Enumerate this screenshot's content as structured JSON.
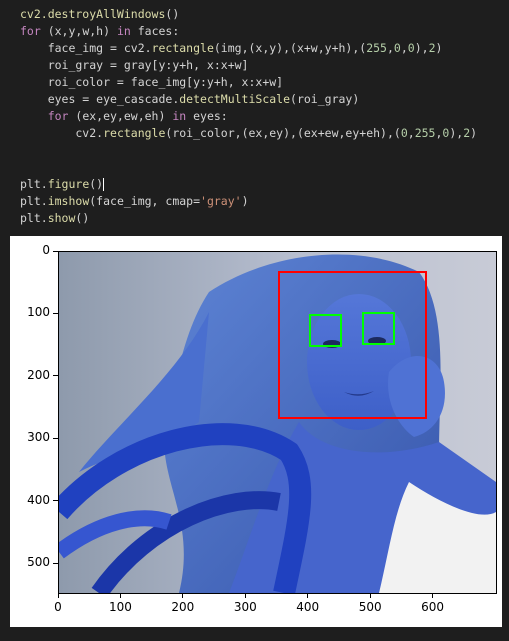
{
  "code": {
    "lines": [
      [
        {
          "t": "cv2.destroyAllWindows",
          "c": "fn"
        },
        {
          "t": "()",
          "c": "pl"
        }
      ],
      [
        {
          "t": "for",
          "c": "kw2"
        },
        {
          "t": " (x,y,w,h) ",
          "c": "pl"
        },
        {
          "t": "in",
          "c": "kw2"
        },
        {
          "t": " faces:",
          "c": "pl"
        }
      ],
      [
        {
          "t": "    face_img = cv2.",
          "c": "pl"
        },
        {
          "t": "rectangle",
          "c": "fn"
        },
        {
          "t": "(img,(x,y),(x+w,y+h),(",
          "c": "pl"
        },
        {
          "t": "255",
          "c": "num"
        },
        {
          "t": ",",
          "c": "pl"
        },
        {
          "t": "0",
          "c": "num"
        },
        {
          "t": ",",
          "c": "pl"
        },
        {
          "t": "0",
          "c": "num"
        },
        {
          "t": "),",
          "c": "pl"
        },
        {
          "t": "2",
          "c": "num"
        },
        {
          "t": ")",
          "c": "pl"
        }
      ],
      [
        {
          "t": "    roi_gray = gray[y:y+h, x:x+w]",
          "c": "pl"
        }
      ],
      [
        {
          "t": "    roi_color = face_img[y:y+h, x:x+w]",
          "c": "pl"
        }
      ],
      [
        {
          "t": "    eyes = eye_cascade.",
          "c": "pl"
        },
        {
          "t": "detectMultiScale",
          "c": "fn"
        },
        {
          "t": "(roi_gray)",
          "c": "pl"
        }
      ],
      [
        {
          "t": "    for",
          "c": "kw2"
        },
        {
          "t": " (ex,ey,ew,eh) ",
          "c": "pl"
        },
        {
          "t": "in",
          "c": "kw2"
        },
        {
          "t": " eyes:",
          "c": "pl"
        }
      ],
      [
        {
          "t": "        cv2.",
          "c": "pl"
        },
        {
          "t": "rectangle",
          "c": "fn"
        },
        {
          "t": "(roi_color,(ex,ey),(ex+ew,ey+eh),(",
          "c": "pl"
        },
        {
          "t": "0",
          "c": "num"
        },
        {
          "t": ",",
          "c": "pl"
        },
        {
          "t": "255",
          "c": "num"
        },
        {
          "t": ",",
          "c": "pl"
        },
        {
          "t": "0",
          "c": "num"
        },
        {
          "t": "),",
          "c": "pl"
        },
        {
          "t": "2",
          "c": "num"
        },
        {
          "t": ")",
          "c": "pl"
        }
      ],
      [],
      [],
      [
        {
          "t": "plt.",
          "c": "pl"
        },
        {
          "t": "figure",
          "c": "fn"
        },
        {
          "t": "()",
          "c": "pl"
        },
        {
          "t": "",
          "c": "cursor"
        }
      ],
      [
        {
          "t": "plt.",
          "c": "pl"
        },
        {
          "t": "imshow",
          "c": "fn"
        },
        {
          "t": "(face_img, cmap=",
          "c": "pl"
        },
        {
          "t": "'gray'",
          "c": "str"
        },
        {
          "t": ")",
          "c": "pl"
        }
      ],
      [
        {
          "t": "plt.",
          "c": "pl"
        },
        {
          "t": "show",
          "c": "fn"
        },
        {
          "t": "()",
          "c": "pl"
        }
      ]
    ]
  },
  "plot": {
    "x_ticks": [
      "0",
      "100",
      "200",
      "300",
      "400",
      "500",
      "600"
    ],
    "y_ticks": [
      "0",
      "100",
      "200",
      "300",
      "400",
      "500"
    ],
    "face_box_color": "#ff0000",
    "eye_box_color": "#00ff00"
  }
}
